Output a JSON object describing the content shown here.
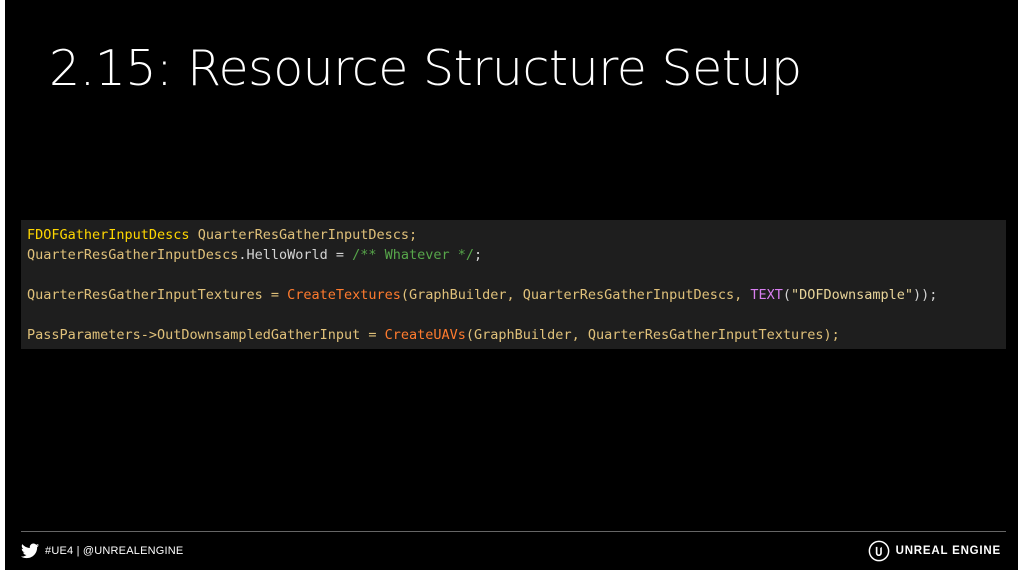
{
  "slide": {
    "title": "2.15: Resource Structure Setup",
    "code": {
      "line1": {
        "type": "FDOFGatherInputDescs",
        "rest": " QuarterResGatherInputDescs;"
      },
      "line2": {
        "obj": "QuarterResGatherInputDescs",
        "member": ".HelloWorld = ",
        "comment": "/** Whatever */",
        "end": ";"
      },
      "line3": {
        "lhs": "QuarterResGatherInputTextures = ",
        "func": "CreateTextures",
        "args1": "(GraphBuilder, QuarterResGatherInputDescs, ",
        "macro": "TEXT",
        "paren_open": "(",
        "string": "\"DOFDownsample\"",
        "paren_close": "));"
      },
      "line4": {
        "lhs1": "PassParameters->",
        "lhs2": "OutDownsampledGatherInput = ",
        "func": "CreateUAVs",
        "args": "(GraphBuilder, QuarterResGatherInputTextures);"
      }
    },
    "footer": {
      "social_icon": "twitter-icon",
      "handle": "#UE4 | @UNREALENGINE",
      "brand_icon": "unreal-engine-logo",
      "brand": "UNREAL ENGINE"
    }
  }
}
